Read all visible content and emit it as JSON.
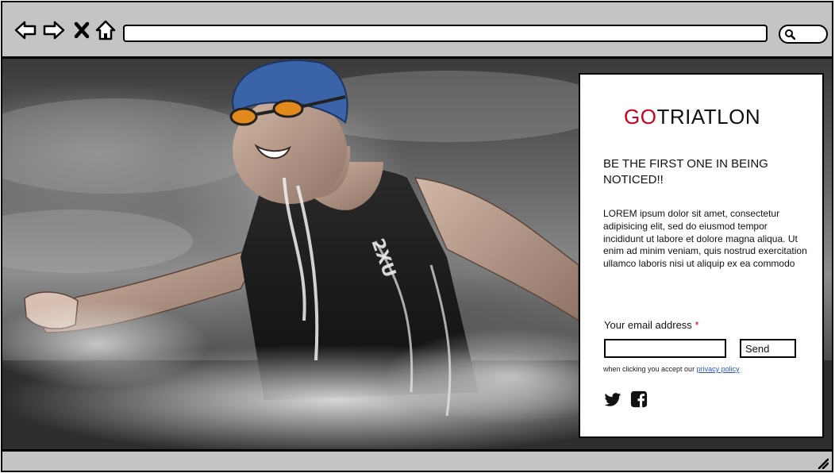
{
  "browser": {
    "nav_icons": [
      "back-arrow-icon",
      "forward-arrow-icon",
      "close-icon",
      "home-icon"
    ],
    "url": "",
    "search_icon": "search-icon"
  },
  "hero": {
    "image": "swimmer emerging from water with splash",
    "suit_print": "2XU"
  },
  "signup": {
    "brand_accent": "GO",
    "brand_rest": "TRIATLON",
    "brand_accent_color": "#c8001e",
    "headline": "BE THE FIRST ONE IN BEING NOTICED!!",
    "body": "LOREM ipsum dolor sit amet, consectetur adipisicing elit, sed do eiusmod tempor incididunt ut labore et dolore magna aliqua. Ut enim ad minim veniam, quis nostrud exercitation ullamco laboris nisi ut aliquip ex ea commodo",
    "email_label": "Your email address",
    "required_mark": "*",
    "email_value": "",
    "send_label": "Send",
    "consent_prefix": "when clicking you accept our",
    "privacy_link": "privacy policy",
    "social": [
      "twitter-icon",
      "facebook-icon"
    ]
  }
}
